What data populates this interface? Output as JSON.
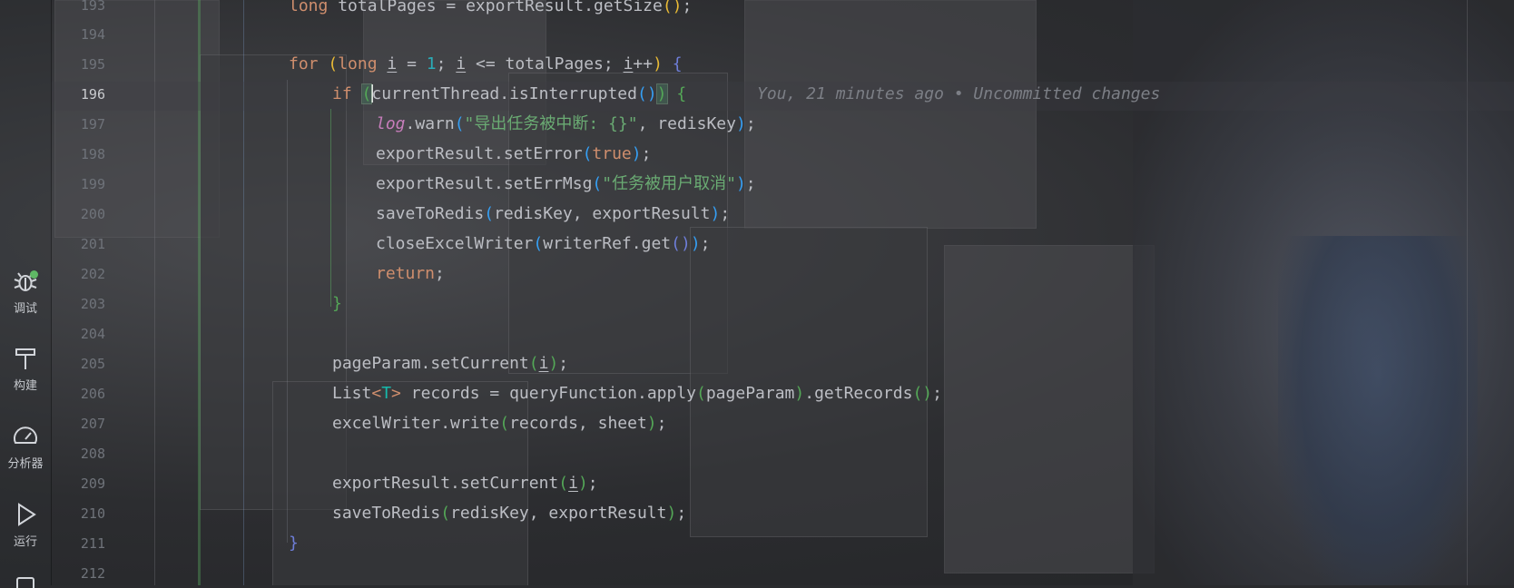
{
  "tool_window": {
    "items": [
      {
        "label": "调试",
        "icon": "debug-icon"
      },
      {
        "label": "构建",
        "icon": "hammer-icon"
      },
      {
        "label": "分析器",
        "icon": "speedometer-icon"
      },
      {
        "label": "运行",
        "icon": "play-icon"
      }
    ],
    "debug_status_color": "#5fb865"
  },
  "gutter": {
    "line_numbers": [
      "193",
      "194",
      "195",
      "196",
      "197",
      "198",
      "199",
      "200",
      "201",
      "202",
      "203",
      "204",
      "205",
      "206",
      "207",
      "208",
      "209",
      "210",
      "211",
      "212"
    ],
    "current_line": "196"
  },
  "editor": {
    "blame_annotation": "You, 21 minutes ago • Uncommitted changes",
    "lines": {
      "l193": "long totalPages = exportResult.getSize();",
      "l195": "for (long i = 1; i <= totalPages; i++) {",
      "l196": "if (currentThread.isInterrupted()) {",
      "l197": "log.warn(\"导出任务被中断: {}\", redisKey);",
      "l198": "exportResult.setError(true);",
      "l199": "exportResult.setErrMsg(\"任务被用户取消\");",
      "l200": "saveToRedis(redisKey, exportResult);",
      "l201": "closeExcelWriter(writerRef.get());",
      "l202": "return;",
      "l203": "}",
      "l205": "pageParam.setCurrent(i);",
      "l206": "List<T> records = queryFunction.apply(pageParam).getRecords();",
      "l207": "excelWriter.write(records, sheet);",
      "l209": "exportResult.setCurrent(i);",
      "l210": "saveToRedis(redisKey, exportResult);",
      "l211": "}"
    },
    "tokens": {
      "long": "long",
      "totalPages": "totalPages",
      "eq": " = ",
      "exportResult": "exportResult",
      "getSize": ".getSize",
      "for": "for",
      "i": "i",
      "one": "1",
      "semi": ";",
      "le": " <= ",
      "inc": "++",
      "if": "if",
      "currentThread": "currentThread.isInterrupted",
      "log": "log",
      "warn": ".warn",
      "warn_str": "\"导出任务被中断: {}\"",
      "redisKey": "redisKey",
      "setError": "exportResult.setError",
      "true": "true",
      "setErrMsg": "exportResult.setErrMsg",
      "errmsg_str": "\"任务被用户取消\"",
      "saveToRedis": "saveToRedis",
      "comma_redis": "redisKey, exportResult",
      "closeExcelWriter": "closeExcelWriter",
      "writerRefGet": "writerRef.get",
      "return": "return",
      "setCurrentPage": "pageParam.setCurrent",
      "List": "List",
      "T": "T",
      "records_eq": " records = queryFunction.apply",
      "pageParam": "pageParam",
      "getRecords": ".getRecords",
      "excelWrite": "excelWriter.write",
      "records_sheet": "records, sheet",
      "setCurrent": "exportResult.setCurrent"
    }
  },
  "colors": {
    "keyword": "#cf8e6d",
    "number": "#2aacb8",
    "string": "#6aab73",
    "field": "#c77dbb",
    "text": "#bcbec4",
    "paren_level1": "#e8ba36",
    "paren_level2": "#54a857",
    "paren_level3": "#359ff4",
    "paren_level4": "#6e7ed9"
  }
}
